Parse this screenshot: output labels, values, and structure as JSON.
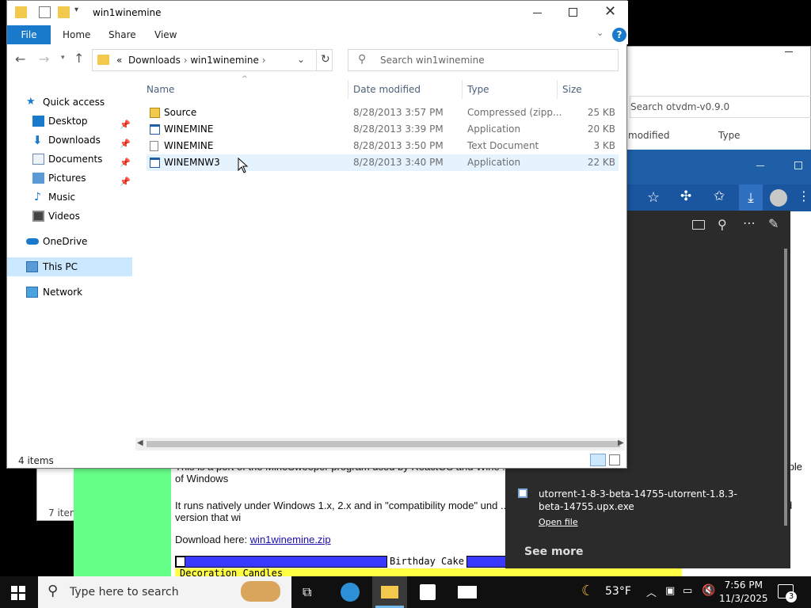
{
  "bg_explorer": {
    "search_placeholder": "Search otvdm-v0.9.0",
    "col_modified": "modified",
    "col_type": "Type",
    "items": "7 item"
  },
  "browser": {
    "para1": "This is a port of the MineSweeper program used by ReactOS and Wine ... de it to recompile for Windows 1. After working around a couple of Windows",
    "para2": "It runs natively under Windows 1.x, 2.x and in \"compatibility mode\" und ... Wind 95/NT or later, but I have included a resource converted version that wi",
    "download_prefix": "Download here: ",
    "download_link": "win1winemine.zip",
    "cake_title": "Birthday Cake",
    "cake_menu": "Decoration  Candles"
  },
  "flyout": {
    "download_name": "utorrent-1-8-3-beta-14755-utorrent-1.8.3-beta-14755.upx.exe",
    "open_file": "Open file",
    "see_more": "See more"
  },
  "explorer": {
    "title": "win1winemine",
    "ribbon": {
      "file": "File",
      "home": "Home",
      "share": "Share",
      "view": "View",
      "help": "?"
    },
    "address": {
      "prefix": "«",
      "crumb1": "Downloads",
      "crumb2": "win1winemine"
    },
    "search_placeholder": "Search win1winemine",
    "nav": [
      {
        "label": "Quick access",
        "icon": "star-icon"
      },
      {
        "label": "Desktop",
        "icon": "desktop-icon",
        "pinned": true
      },
      {
        "label": "Downloads",
        "icon": "download-icon",
        "pinned": true
      },
      {
        "label": "Documents",
        "icon": "documents-icon",
        "pinned": true
      },
      {
        "label": "Pictures",
        "icon": "pictures-icon",
        "pinned": true
      },
      {
        "label": "Music",
        "icon": "music-icon"
      },
      {
        "label": "Videos",
        "icon": "videos-icon"
      },
      {
        "label": "OneDrive",
        "icon": "cloud-icon"
      },
      {
        "label": "This PC",
        "icon": "computer-icon",
        "selected": true
      },
      {
        "label": "Network",
        "icon": "network-icon"
      }
    ],
    "columns": {
      "name": "Name",
      "date": "Date modified",
      "type": "Type",
      "size": "Size"
    },
    "files": [
      {
        "name": "Source",
        "date": "8/28/2013 3:57 PM",
        "type": "Compressed (zipp...",
        "size": "25 KB",
        "icon": "zip-folder-icon"
      },
      {
        "name": "WINEMINE",
        "date": "8/28/2013 3:39 PM",
        "type": "Application",
        "size": "20 KB",
        "icon": "application-icon"
      },
      {
        "name": "WINEMINE",
        "date": "8/28/2013 3:50 PM",
        "type": "Text Document",
        "size": "3 KB",
        "icon": "text-document-icon"
      },
      {
        "name": "WINEMNW3",
        "date": "8/28/2013 3:40 PM",
        "type": "Application",
        "size": "22 KB",
        "icon": "application-icon",
        "hovered": true
      }
    ],
    "status": "4 items"
  },
  "taskbar": {
    "search_placeholder": "Type here to search",
    "temperature": "53°F",
    "time": "7:56 PM",
    "date": "11/3/2025",
    "notifications": "3"
  },
  "colors": {
    "accent": "#1979ca",
    "selection": "#e5f3ff",
    "taskbar": "#101010",
    "flyout": "#2b2b2b"
  }
}
